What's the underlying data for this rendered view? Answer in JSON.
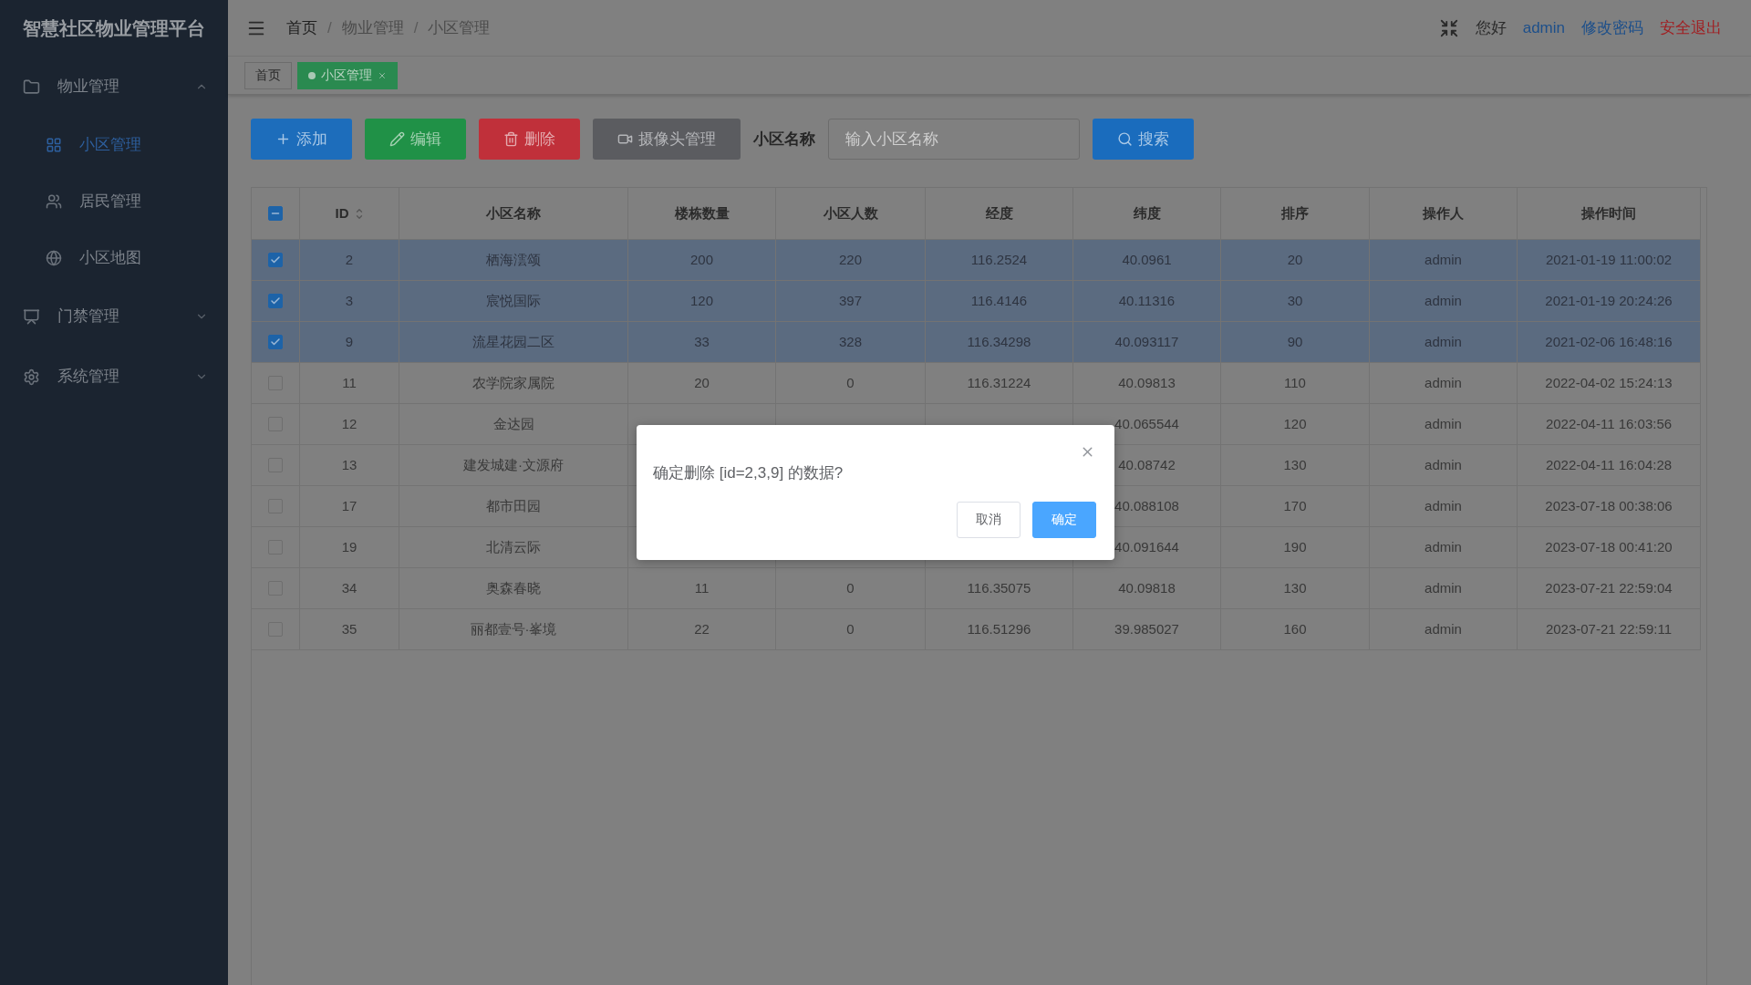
{
  "sidebar": {
    "title": "智慧社区物业管理平台",
    "items": [
      {
        "label": "物业管理",
        "expanded": true,
        "children": [
          {
            "label": "小区管理",
            "selected": true
          },
          {
            "label": "居民管理",
            "selected": false
          },
          {
            "label": "小区地图",
            "selected": false
          }
        ]
      },
      {
        "label": "门禁管理",
        "expanded": false
      },
      {
        "label": "系统管理",
        "expanded": false
      }
    ]
  },
  "header": {
    "breadcrumb": [
      "首页",
      "物业管理",
      "小区管理"
    ],
    "separators": [
      "/",
      "/"
    ],
    "greeting": "您好",
    "user": "admin",
    "change_password": "修改密码",
    "logout": "安全退出"
  },
  "tabs": [
    {
      "label": "首页",
      "selected": false
    },
    {
      "label": "小区管理",
      "selected": true
    }
  ],
  "toolbar": {
    "buttons": [
      {
        "label": "添加",
        "kind": "primary"
      },
      {
        "label": "编辑",
        "kind": "success"
      },
      {
        "label": "删除",
        "kind": "danger"
      },
      {
        "label": "摄像头管理",
        "kind": "neutral"
      }
    ],
    "search_label": "小区名称",
    "search_placeholder": "输入小区名称",
    "search_button": "搜索"
  },
  "table": {
    "select_all": {
      "indeterminate": true
    },
    "columns": [
      {
        "label": "ID",
        "sortable": true
      },
      {
        "label": "小区名称",
        "sortable": false
      },
      {
        "label": "楼栋数量",
        "sortable": false
      },
      {
        "label": "小区人数",
        "sortable": false
      },
      {
        "label": "经度",
        "sortable": false
      },
      {
        "label": "纬度",
        "sortable": false
      },
      {
        "label": "排序",
        "sortable": false
      },
      {
        "label": "操作人",
        "sortable": false
      },
      {
        "label": "操作时间",
        "sortable": false
      }
    ],
    "rows": [
      {
        "selected": true,
        "cells": [
          "2",
          "栖海澐颂",
          "200",
          "220",
          "116.2524",
          "40.0961",
          "20",
          "admin",
          "2021-01-19 11:00:02"
        ]
      },
      {
        "selected": true,
        "cells": [
          "3",
          "宸悦国际",
          "120",
          "397",
          "116.4146",
          "40.11316",
          "30",
          "admin",
          "2021-01-19 20:24:26"
        ]
      },
      {
        "selected": true,
        "cells": [
          "9",
          "流星花园二区",
          "33",
          "328",
          "116.34298",
          "40.093117",
          "90",
          "admin",
          "2021-02-06 16:48:16"
        ]
      },
      {
        "selected": false,
        "cells": [
          "11",
          "农学院家属院",
          "20",
          "0",
          "116.31224",
          "40.09813",
          "110",
          "admin",
          "2022-04-02 15:24:13"
        ]
      },
      {
        "selected": false,
        "cells": [
          "12",
          "金达园",
          null,
          null,
          null,
          "40.065544",
          "120",
          "admin",
          "2022-04-11 16:03:56"
        ]
      },
      {
        "selected": false,
        "cells": [
          "13",
          "建发城建·文源府",
          null,
          null,
          null,
          "40.08742",
          "130",
          "admin",
          "2022-04-11 16:04:28"
        ]
      },
      {
        "selected": false,
        "cells": [
          "17",
          "都市田园",
          null,
          null,
          null,
          "40.088108",
          "170",
          "admin",
          "2023-07-18 00:38:06"
        ]
      },
      {
        "selected": false,
        "cells": [
          "19",
          "北清云际",
          null,
          null,
          null,
          "40.091644",
          "190",
          "admin",
          "2023-07-18 00:41:20"
        ]
      },
      {
        "selected": false,
        "cells": [
          "34",
          "奥森春晓",
          "11",
          "0",
          "116.35075",
          "40.09818",
          "130",
          "admin",
          "2023-07-21 22:59:04"
        ]
      },
      {
        "selected": false,
        "cells": [
          "35",
          "丽都壹号·峯境",
          "22",
          "0",
          "116.51296",
          "39.985027",
          "160",
          "admin",
          "2023-07-21 22:59:11"
        ]
      }
    ]
  },
  "dialog": {
    "message": "确定删除 [id=2,3,9] 的数据?",
    "buttons": [
      {
        "label": "取消",
        "kind": "default"
      },
      {
        "label": "确定",
        "kind": "primary"
      }
    ]
  }
}
